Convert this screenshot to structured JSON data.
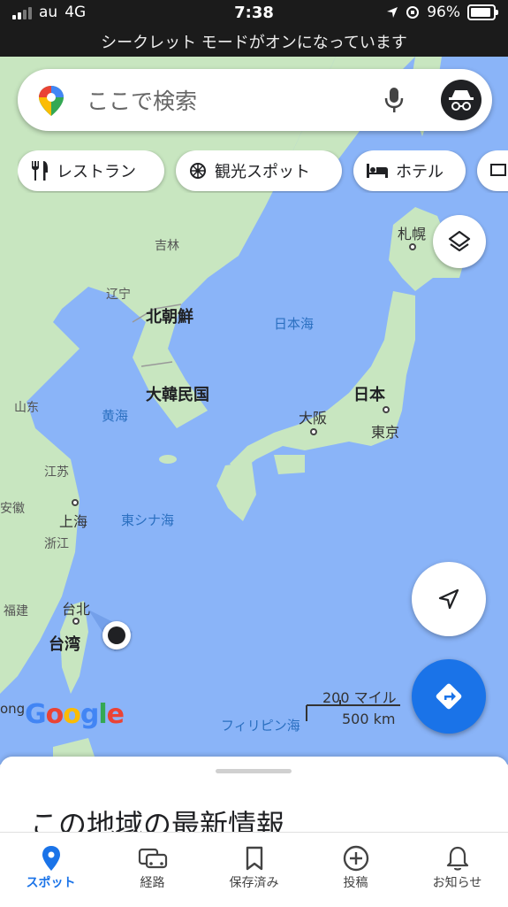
{
  "status_bar": {
    "carrier": "au",
    "network": "4G",
    "time": "7:38",
    "battery": "96%",
    "banner": "シークレット モードがオンになっています"
  },
  "search": {
    "placeholder": "ここで検索"
  },
  "chips": [
    {
      "label": "レストラン",
      "icon": "restaurant-icon"
    },
    {
      "label": "観光スポット",
      "icon": "attraction-icon"
    },
    {
      "label": "ホテル",
      "icon": "hotel-icon"
    }
  ],
  "map": {
    "labels": {
      "jilin": "吉林",
      "liaoning": "辽宁",
      "north_korea": "北朝鮮",
      "south_korea": "大韓民国",
      "sea_of_japan": "日本海",
      "yellow_sea": "黄海",
      "shandong": "山东",
      "jiangsu": "江苏",
      "anhui": "安徽",
      "shanghai": "上海",
      "zhejiang": "浙江",
      "east_china_sea": "東シナ海",
      "fujian": "福建",
      "taipei": "台北",
      "taiwan": "台湾",
      "japan": "日本",
      "osaka": "大阪",
      "tokyo": "東京",
      "sapporo": "札幌",
      "philippine_sea": "フィリピン海",
      "ong": "ong"
    },
    "scale_miles": "200 マイル",
    "scale_km": "500 km",
    "google": "Google"
  },
  "sheet": {
    "title": "この地域の最新情報"
  },
  "nav": [
    {
      "label": "スポット",
      "icon": "location-pin-icon",
      "active": true
    },
    {
      "label": "経路",
      "icon": "car-icon",
      "active": false
    },
    {
      "label": "保存済み",
      "icon": "bookmark-icon",
      "active": false
    },
    {
      "label": "投稿",
      "icon": "add-circle-icon",
      "active": false
    },
    {
      "label": "お知らせ",
      "icon": "bell-icon",
      "active": false
    }
  ],
  "colors": {
    "water": "#8ab4f8",
    "land": "#c8e6c0",
    "accent": "#1a73e8"
  }
}
